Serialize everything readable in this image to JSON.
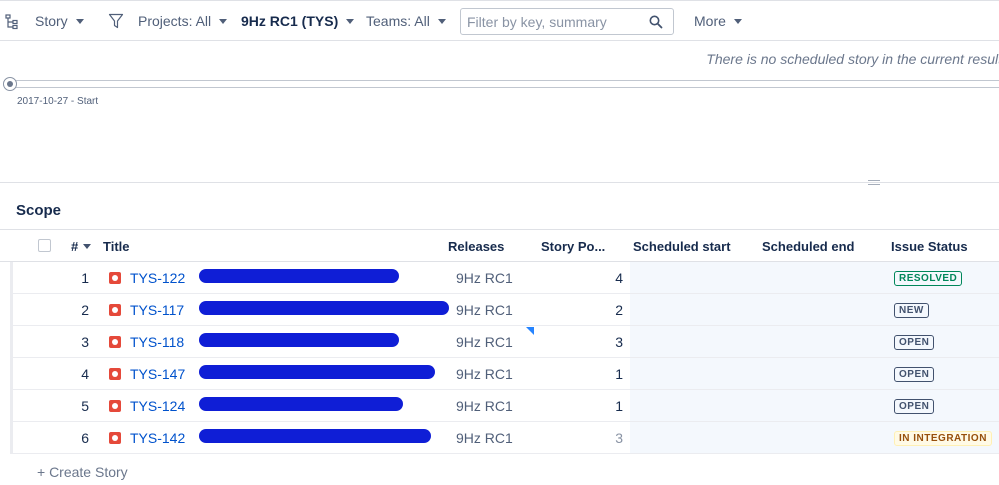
{
  "toolbar": {
    "story_label": "Story",
    "projects_label": "Projects: All",
    "release_label": "9Hz RC1 (TYS)",
    "teams_label": "Teams: All",
    "search_placeholder": "Filter by key, summary",
    "more_label": "More"
  },
  "timeline": {
    "notice": "There is no scheduled story in the current results",
    "start_label": "2017-10-27 - Start"
  },
  "scope": {
    "title": "Scope",
    "columns": {
      "num": "#",
      "title": "Title",
      "releases": "Releases",
      "story_points": "Story Po...",
      "scheduled_start": "Scheduled start",
      "scheduled_end": "Scheduled end",
      "issue_status": "Issue Status"
    },
    "rows": [
      {
        "num": "1",
        "key": "TYS-122",
        "release": "9Hz RC1",
        "points": "4",
        "status": "RESOLVED"
      },
      {
        "num": "2",
        "key": "TYS-117",
        "release": "9Hz RC1",
        "points": "2",
        "status": "NEW"
      },
      {
        "num": "3",
        "key": "TYS-118",
        "release": "9Hz RC1",
        "points": "3",
        "status": "OPEN"
      },
      {
        "num": "4",
        "key": "TYS-147",
        "release": "9Hz RC1",
        "points": "1",
        "status": "OPEN"
      },
      {
        "num": "5",
        "key": "TYS-124",
        "release": "9Hz RC1",
        "points": "1",
        "status": "OPEN"
      },
      {
        "num": "6",
        "key": "TYS-142",
        "release": "9Hz RC1",
        "points": "3",
        "status": "IN INTEGRATION"
      }
    ],
    "create_label": "+ Create Story"
  },
  "colors": {
    "link": "#0052cc",
    "bug": "#e5493a",
    "redaction": "#0f1ed6",
    "resolved": "#00875a",
    "integration": "#974f0c"
  },
  "icons": [
    "hierarchy-icon",
    "filter-icon",
    "search-icon",
    "bug-icon"
  ]
}
